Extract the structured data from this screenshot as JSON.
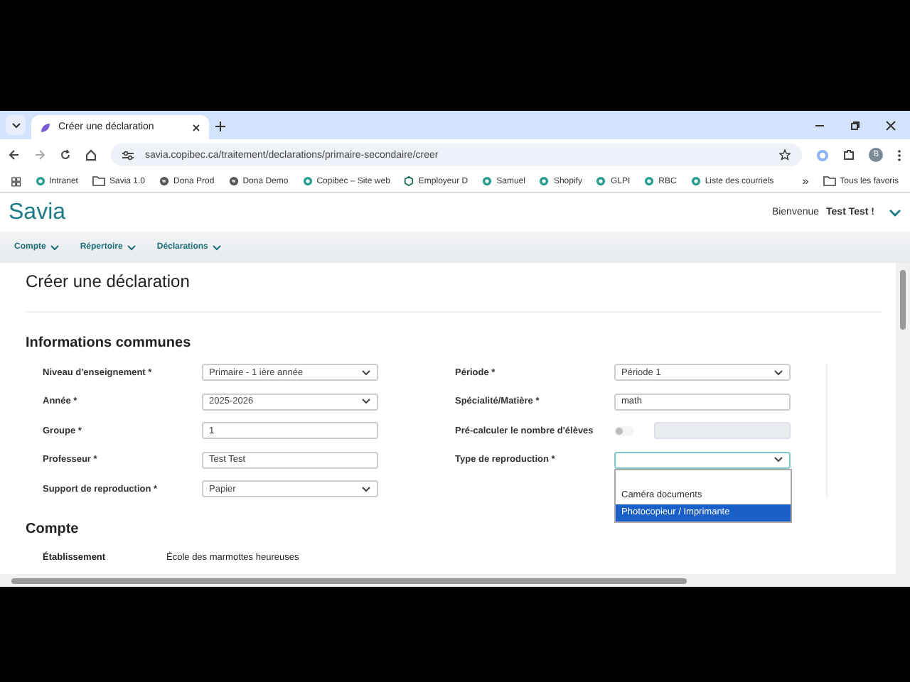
{
  "browser": {
    "tab": {
      "title": "Créer une déclaration"
    },
    "url": "savia.copibec.ca/traitement/declarations/primaire-secondaire/creer",
    "profile": "B",
    "bookmarks": [
      {
        "label": "Intranet",
        "kind": "site"
      },
      {
        "label": "Savia 1.0",
        "kind": "folder"
      },
      {
        "label": "Dona Prod",
        "kind": "globe"
      },
      {
        "label": "Dona Demo",
        "kind": "globe"
      },
      {
        "label": "Copibec – Site web",
        "kind": "site"
      },
      {
        "label": "Employeur D",
        "kind": "hex"
      },
      {
        "label": "Samuel",
        "kind": "site"
      },
      {
        "label": "Shopify",
        "kind": "site"
      },
      {
        "label": "GLPI",
        "kind": "site"
      },
      {
        "label": "RBC",
        "kind": "site"
      },
      {
        "label": "Liste des courriels",
        "kind": "site"
      }
    ],
    "overflow": "»",
    "all_bookmarks": "Tous les favoris"
  },
  "header": {
    "logo": "Savia",
    "welcome": "Bienvenue",
    "user": "Test Test !"
  },
  "nav": [
    "Compte",
    "Répertoire",
    "Déclarations"
  ],
  "page_title": "Créer une déclaration",
  "section": "Informations communes",
  "left_fields": [
    {
      "label": "Niveau d'enseignement *",
      "kind": "select",
      "value": "Primaire - 1 ière année"
    },
    {
      "label": "Année *",
      "kind": "select",
      "value": "2025-2026"
    },
    {
      "label": "Groupe *",
      "kind": "input",
      "value": "1"
    },
    {
      "label": "Professeur *",
      "kind": "input",
      "value": "Test Test"
    },
    {
      "label": "Support de reproduction *",
      "kind": "select",
      "value": "Papier"
    }
  ],
  "right_fields": [
    {
      "label": "Période *",
      "kind": "select",
      "value": "Période 1"
    },
    {
      "label": "Spécialité/Matière *",
      "kind": "input",
      "value": "math"
    },
    {
      "label": "Pré-calculer le nombre d'élèves",
      "kind": "toggle",
      "on": false,
      "disabled": true
    },
    {
      "label": "Type de reproduction *",
      "kind": "select",
      "open": true,
      "options": [
        {
          "label": "Caméra documents",
          "selected": false
        },
        {
          "label": "Photocopieur / Imprimante",
          "selected": true
        }
      ]
    }
  ],
  "account": {
    "title": "Compte",
    "label": "Établissement",
    "value": "École des marmottes heureuses"
  }
}
